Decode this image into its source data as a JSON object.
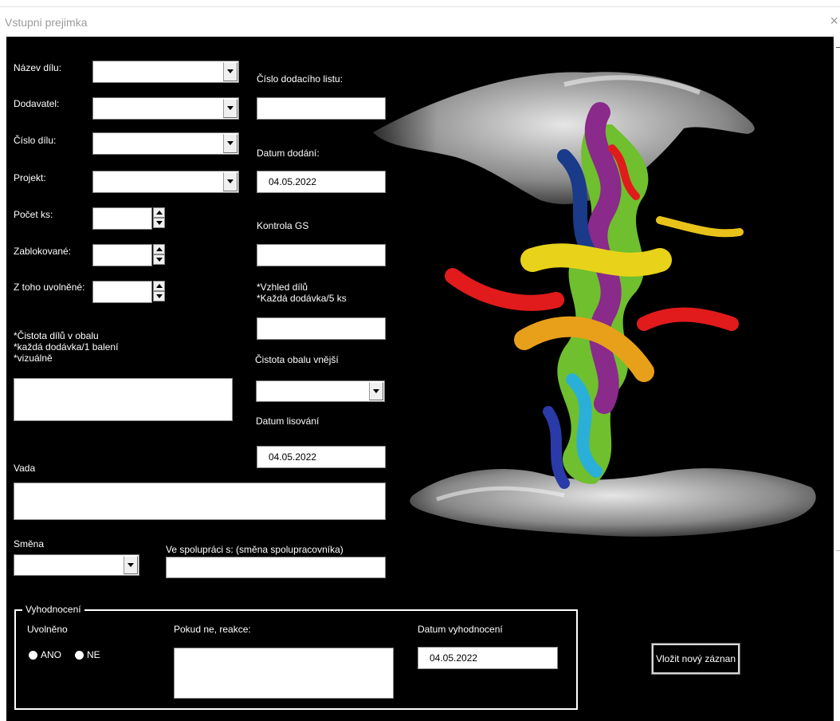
{
  "window": {
    "title": "Vstupni prejimka",
    "close_glyph": "×"
  },
  "fields": {
    "nazev_dilu_label": "Název dílu:",
    "dodavatel_label": "Dodavatel:",
    "cislo_dilu_label": "Číslo dílu:",
    "projekt_label": "Projekt:",
    "pocet_ks_label": "Počet ks:",
    "zablokovane_label": "Zablokované:",
    "z_toho_uvolnene_label": "Z toho uvolněné:",
    "cistota_dilu_label": "*Čistota dílů v obalu\n*každá dodávka/1 balení\n*vizuálně",
    "vada_label": "Vada",
    "smena_label": "Směna",
    "ve_spolupraci_label": "Ve spolupráci s: (směna spolupracovníka)",
    "cislo_dodaciho_listu_label": "Číslo dodacího listu:",
    "datum_dodani_label": "Datum dodání:",
    "datum_dodani_value": "04.05.2022",
    "kontrola_gs_label": "Kontrola GS",
    "vzhled_dilu_label": "*Vzhled dílů\n*Každá dodávka/5 ks",
    "cistota_obalu_label": "Čistota obalu vnější",
    "datum_lisovani_label": "Datum lisování",
    "datum_lisovani_value": "04.05.2022"
  },
  "evaluation": {
    "legend": "Vyhodnocení",
    "uvolneno_label": "Uvolněno",
    "ano_label": "ANO",
    "ne_label": "NE",
    "reakce_label": "Pokud ne, reakce:",
    "datum_vyhodnoceni_label": "Datum vyhodnocení",
    "datum_vyhodnoceni_value": "04.05.2022"
  },
  "actions": {
    "insert_label": "Vložit nový záznan"
  },
  "icons": {
    "dropdown": "chevron-down-icon",
    "spin": "spin-arrows-icon",
    "radio": "radio-icon"
  },
  "colors": {
    "form_background": "#000000",
    "field_background": "#ffffff",
    "label_text": "#ffffff"
  }
}
